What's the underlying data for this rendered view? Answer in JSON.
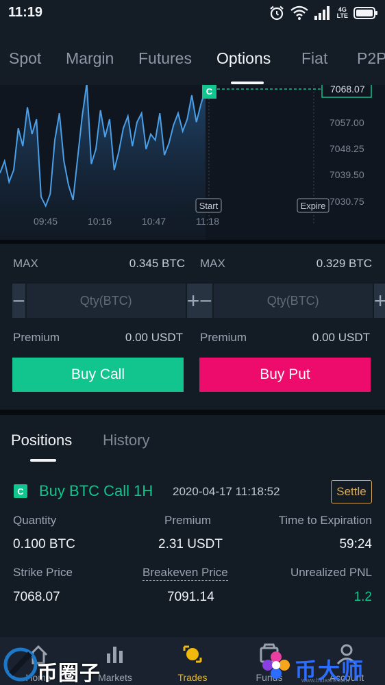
{
  "status_bar": {
    "time": "11:19",
    "network_label_top": "4G",
    "network_label_bottom": "LTE"
  },
  "top_tabs": [
    {
      "label": "Spot",
      "active": false
    },
    {
      "label": "Margin",
      "active": false
    },
    {
      "label": "Futures",
      "active": false
    },
    {
      "label": "Options",
      "active": true
    },
    {
      "label": "Fiat",
      "active": false
    },
    {
      "label": "P2P",
      "active": false
    }
  ],
  "chart": {
    "badge": "C",
    "current_price_label": "7068.07",
    "y_ticks": [
      "7057.00",
      "7048.25",
      "7039.50",
      "7030.75"
    ],
    "x_ticks": [
      "09:45",
      "10:16",
      "10:47",
      "11:18"
    ],
    "start_label": "Start",
    "expire_label": "Expire",
    "line_color": "#4a9fe8",
    "marker_color": "#12c48d"
  },
  "chart_data": {
    "type": "area",
    "x": [
      "09:45",
      "10:16",
      "10:47",
      "11:18"
    ],
    "y_ticks": [
      7057.0,
      7048.25,
      7039.5,
      7030.75
    ],
    "current_price": 7068.07,
    "series": [
      {
        "values": [
          7040,
          7044,
          7037,
          7041,
          7055,
          7049,
          7062,
          7053,
          7058,
          7032,
          7029,
          7033,
          7051,
          7060,
          7044,
          7036,
          7031,
          7045,
          7059,
          7070,
          7043,
          7048,
          7061,
          7052,
          7058,
          7041,
          7047,
          7055,
          7059,
          7049,
          7057,
          7060,
          7048,
          7053,
          7051,
          7060,
          7046,
          7050,
          7056,
          7060,
          7054,
          7058,
          7066,
          7057,
          7063,
          7068
        ]
      }
    ],
    "xlabel": "",
    "ylabel": ""
  },
  "trade": {
    "call": {
      "max_label": "MAX",
      "max_value": "0.345 BTC",
      "qty_placeholder": "Qty(BTC)",
      "minus": "−",
      "plus": "+",
      "premium_label": "Premium",
      "premium_value": "0.00 USDT",
      "button": "Buy Call"
    },
    "put": {
      "max_label": "MAX",
      "max_value": "0.329 BTC",
      "qty_placeholder": "Qty(BTC)",
      "minus": "−",
      "plus": "+",
      "premium_label": "Premium",
      "premium_value": "0.00 USDT",
      "button": "Buy Put"
    }
  },
  "positions": {
    "tabs": [
      "Positions",
      "History"
    ],
    "item": {
      "badge": "C",
      "title": "Buy BTC Call 1H",
      "timestamp": "2020-04-17 11:18:52",
      "settle": "Settle",
      "quantity_label": "Quantity",
      "quantity_value": "0.100 BTC",
      "premium_label": "Premium",
      "premium_value": "2.31 USDT",
      "expiry_label": "Time to Expiration",
      "expiry_value": "59:24",
      "strike_label": "Strike Price",
      "strike_value": "7068.07",
      "breakeven_label": "Breakeven Price",
      "breakeven_value": "7091.14",
      "pnl_label": "Unrealized PNL",
      "pnl_value": "1.2",
      "pnl_color": "#12c48d"
    }
  },
  "bottom_nav": [
    {
      "label": "Home",
      "icon": "home-icon"
    },
    {
      "label": "Markets",
      "icon": "markets-icon"
    },
    {
      "label": "Trades",
      "icon": "trades-icon",
      "active": true
    },
    {
      "label": "Funds",
      "icon": "funds-icon"
    },
    {
      "label": "Account",
      "icon": "account-icon"
    }
  ],
  "watermarks": {
    "left": "币圈子",
    "right": "币大师",
    "right_small": "www.bidashi.com"
  }
}
